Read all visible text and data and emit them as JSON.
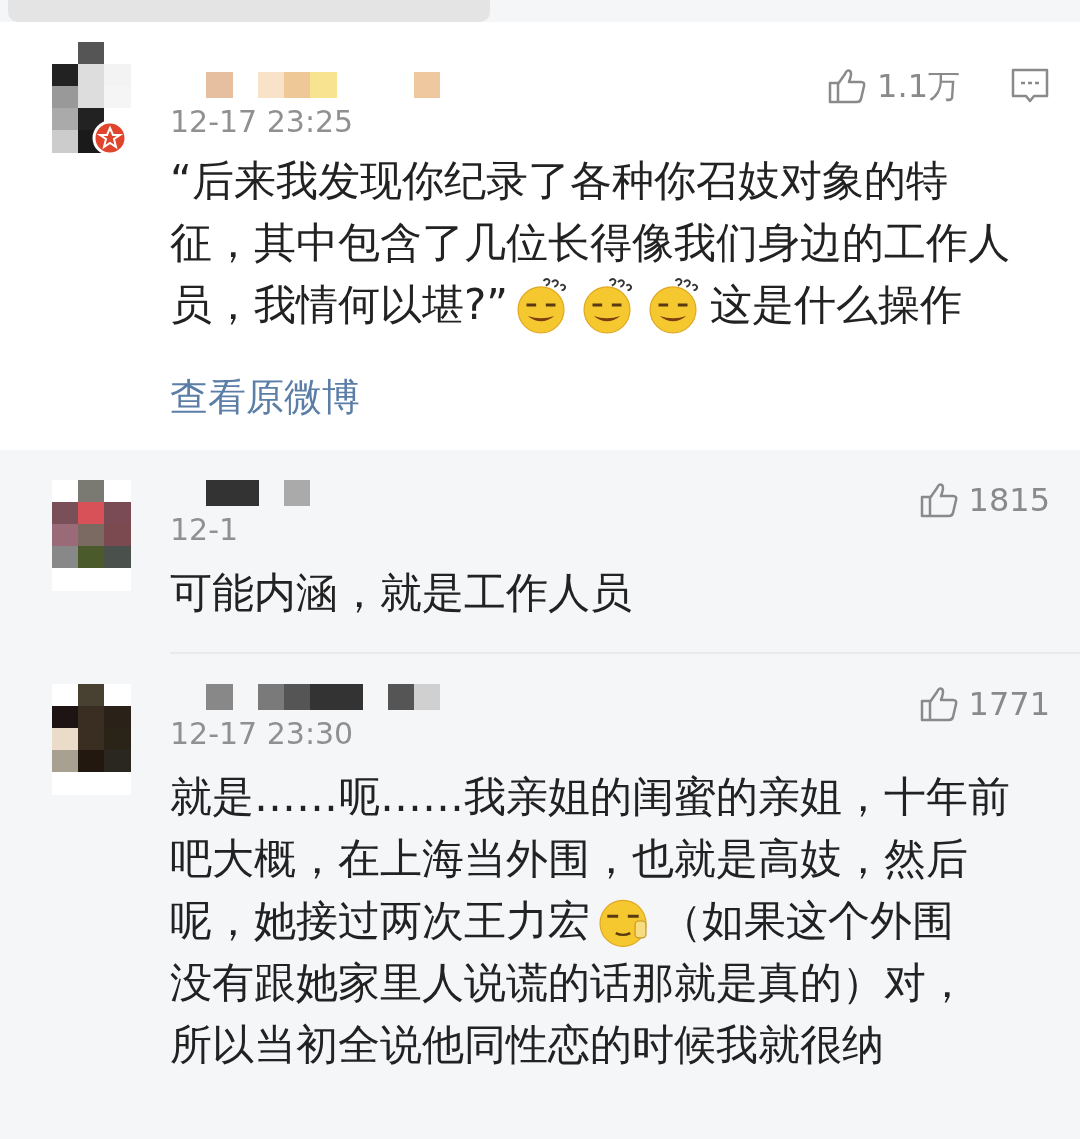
{
  "comments": [
    {
      "kind": "main",
      "verified": true,
      "time": "12-17 23:25",
      "likes": "1.1万",
      "reply_icon": true,
      "lines": [
        [
          {
            "kind": "text",
            "text": "“后来我发现你纪录了各种你召妓对象的特"
          }
        ],
        [
          {
            "kind": "text",
            "text": "征，其中包含了几位长得像我们身边的工作人"
          }
        ],
        [
          {
            "kind": "text",
            "text": "员，我情何以堪?”"
          },
          {
            "kind": "puzzled"
          },
          {
            "kind": "puzzled"
          },
          {
            "kind": "puzzled"
          },
          {
            "kind": "text",
            "text": "这是什么操作"
          }
        ]
      ],
      "link": "查看原微博"
    },
    {
      "kind": "reply",
      "verified": false,
      "time": "12-1",
      "likes": "1815",
      "reply_icon": false,
      "lines": [
        [
          {
            "kind": "text",
            "text": "可能内涵，就是工作人员"
          }
        ]
      ]
    },
    {
      "kind": "reply",
      "verified": false,
      "time": "12-17 23:30",
      "likes": "1771",
      "reply_icon": false,
      "lines": [
        [
          {
            "kind": "text",
            "text": "就是……呃……我亲姐的闺蜜的亲姐，十年前"
          }
        ],
        [
          {
            "kind": "text",
            "text": "吧大概，在上海当外围，也就是高妓，然后"
          }
        ],
        [
          {
            "kind": "text",
            "text": "呢，她接过两次王力宏"
          },
          {
            "kind": "sly"
          },
          {
            "kind": "text",
            "text": "（如果这个外围"
          }
        ],
        [
          {
            "kind": "text",
            "text": "没有跟她家里人说谎的话那就是真的）对，"
          }
        ],
        [
          {
            "kind": "text",
            "text": "所以当初全说他同性恋的时候我就很纳"
          }
        ]
      ]
    }
  ]
}
